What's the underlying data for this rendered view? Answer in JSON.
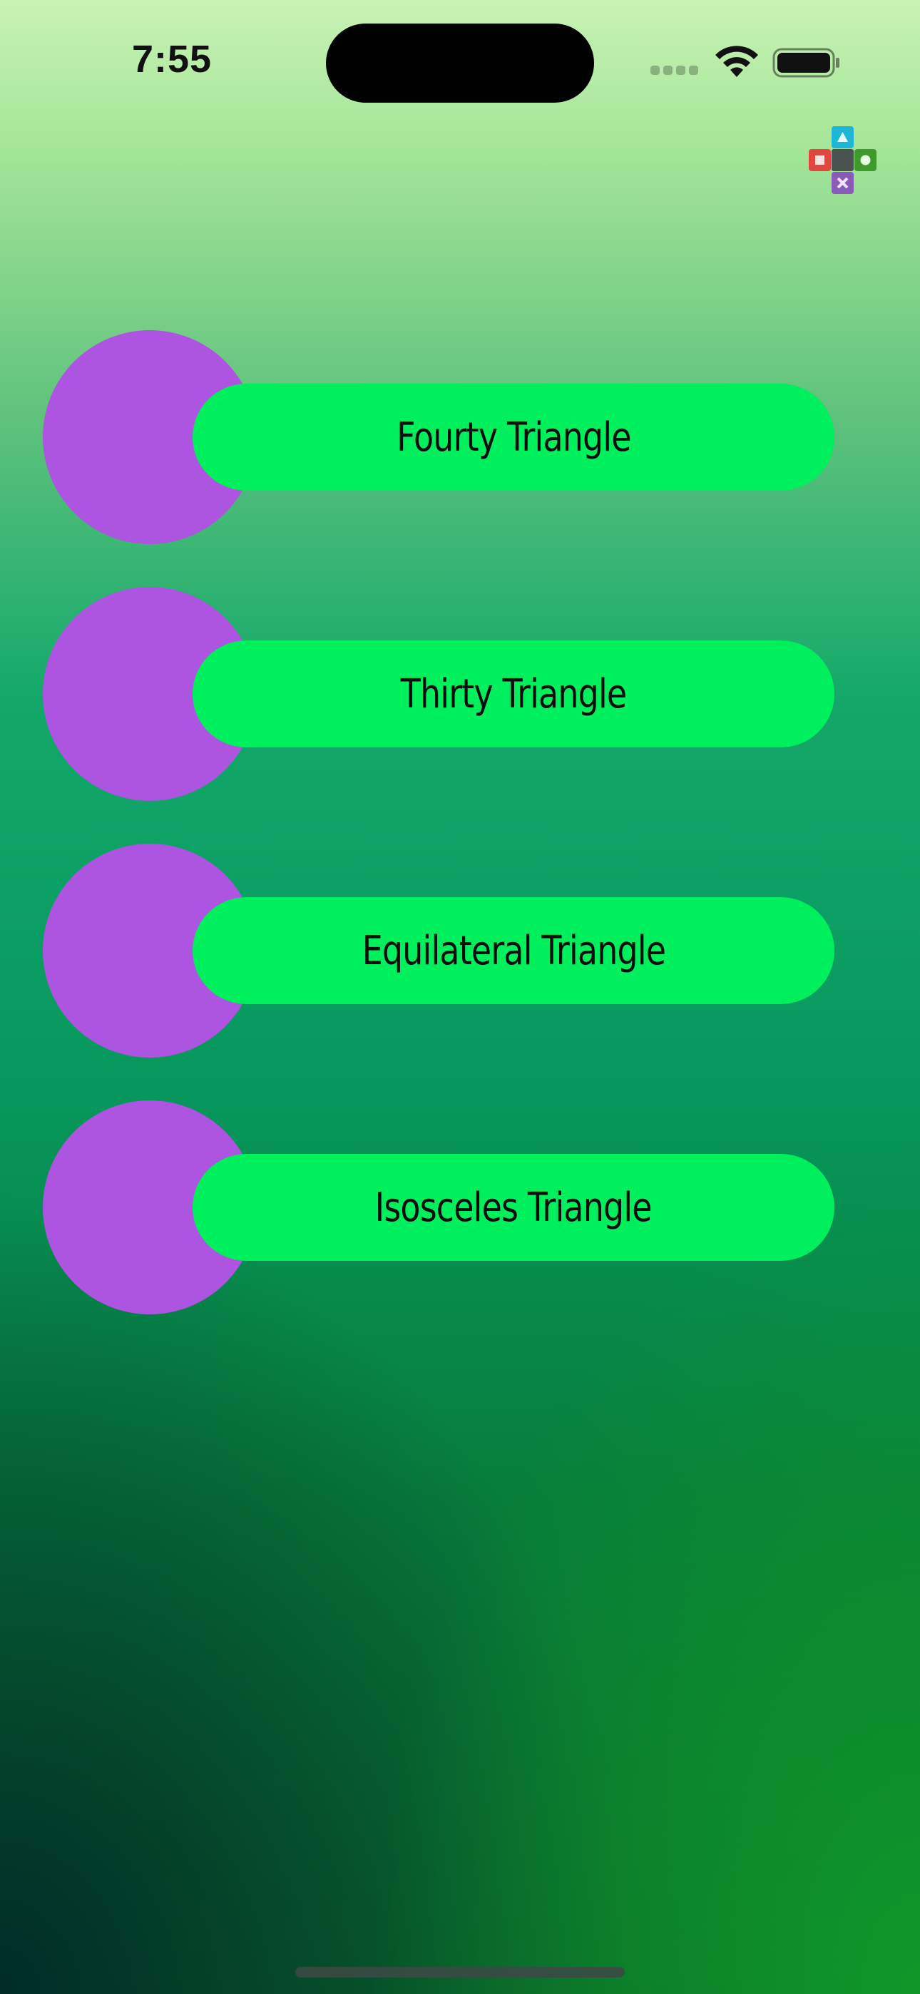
{
  "status_bar": {
    "time": "7:55"
  },
  "app_icon": {
    "name": "shapes-logo-icon"
  },
  "menu": {
    "items": [
      {
        "label": "Fourty Triangle"
      },
      {
        "label": "Thirty Triangle"
      },
      {
        "label": "Equilateral Triangle"
      },
      {
        "label": "Isosceles Triangle"
      }
    ]
  },
  "colors": {
    "circle": "#ad54e0",
    "pill": "#00ef5c",
    "background_top": "#c8f2b4",
    "background_bottom": "#0a6b2a"
  }
}
